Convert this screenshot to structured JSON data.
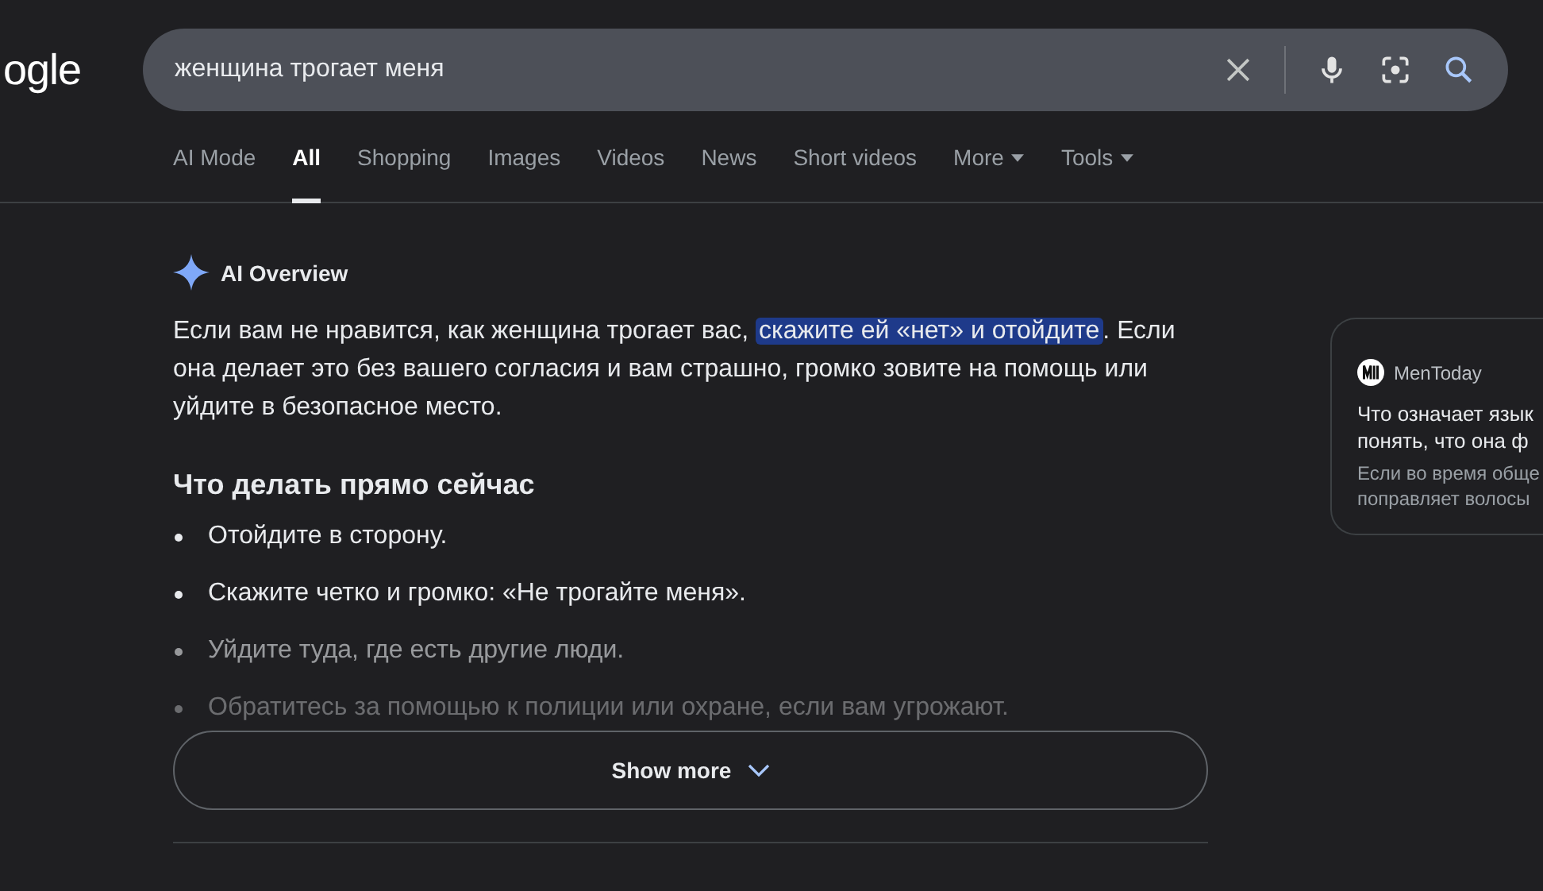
{
  "logo": "ogle",
  "search": {
    "value": "женщина трогает меня"
  },
  "tabs": [
    {
      "label": "AI Mode",
      "selected": false,
      "dropdown": false
    },
    {
      "label": "All",
      "selected": true,
      "dropdown": false
    },
    {
      "label": "Shopping",
      "selected": false,
      "dropdown": false
    },
    {
      "label": "Images",
      "selected": false,
      "dropdown": false
    },
    {
      "label": "Videos",
      "selected": false,
      "dropdown": false
    },
    {
      "label": "News",
      "selected": false,
      "dropdown": false
    },
    {
      "label": "Short videos",
      "selected": false,
      "dropdown": false
    },
    {
      "label": "More",
      "selected": false,
      "dropdown": true
    },
    {
      "label": "Tools",
      "selected": false,
      "dropdown": true
    }
  ],
  "overview": {
    "title": "AI Overview",
    "paragraph": [
      {
        "text": "Если вам не нравится, как женщина трогает вас, ",
        "highlighted": false
      },
      {
        "text": "скажите ей «нет» и отойдите",
        "highlighted": true
      },
      {
        "text": ". Если она делает это без вашего согласия и вам страшно, громко зовите на помощь или уйдите в безопасное место.",
        "highlighted": false
      }
    ],
    "heading": "Что делать прямо сейчас",
    "bullets": [
      {
        "text": "Отойдите в сторону.",
        "kind": "normal"
      },
      {
        "text": "Скажите четко и громко: «Не трогайте меня».",
        "kind": "normal"
      },
      {
        "text": "Уйдите туда, где есть другие люди.",
        "kind": "dim"
      },
      {
        "text": "Обратитесь за помощью к полиции или охране, если вам угрожают.",
        "kind": "faint"
      }
    ],
    "show_more": "Show more"
  },
  "source_card": {
    "source": "MenToday",
    "title": "Что означает язык\nпонять, что она ф",
    "snippet": "Если во время обще\nпоправляет волосы"
  }
}
